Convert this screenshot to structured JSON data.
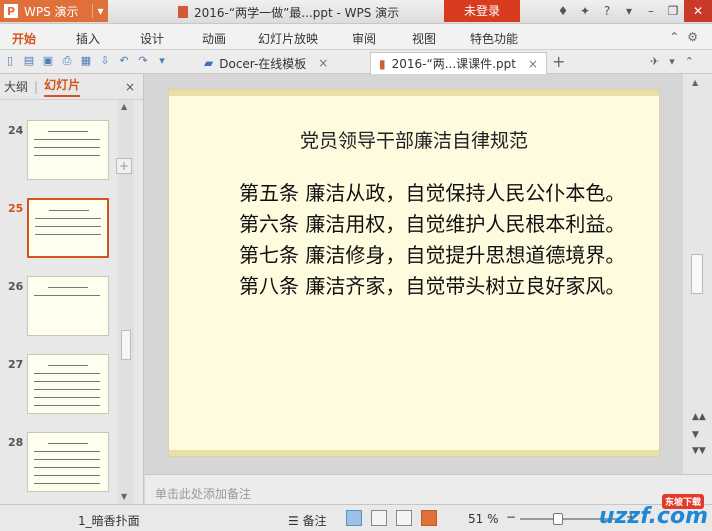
{
  "app": {
    "name": "WPS 演示",
    "doc_title": "2016-“两学一做”最...ppt - WPS 演示",
    "login": "未登录"
  },
  "menu": [
    "开始",
    "插入",
    "设计",
    "动画",
    "幻灯片放映",
    "审阅",
    "视图",
    "特色功能"
  ],
  "tabs": [
    {
      "label": "Docer-在线模板",
      "close": "×"
    },
    {
      "label": "2016-“两...课课件.ppt",
      "close": "×"
    }
  ],
  "sidebar": {
    "outline": "大纲",
    "slides": "幻灯片",
    "close": "×",
    "add": "+"
  },
  "thumbs": [
    {
      "num": "24",
      "lines": 4
    },
    {
      "num": "25",
      "lines": 4,
      "selected": true
    },
    {
      "num": "26",
      "lines": 2
    },
    {
      "num": "27",
      "lines": 6
    },
    {
      "num": "28",
      "lines": 6
    }
  ],
  "slide": {
    "title": "党员领导干部廉洁自律规范",
    "paragraphs": [
      "第五条  廉洁从政，自觉保持人民公仆本色。",
      "第六条  廉洁用权，自觉维护人民根本利益。",
      "第七条  廉洁修身，自觉提升思想道德境界。",
      "第八条  廉洁齐家，自觉带头树立良好家风。"
    ]
  },
  "notes_placeholder": "单击此处添加备注",
  "status": {
    "slide_name": "1_暗香扑面",
    "notes": "备注",
    "zoom": "51 %",
    "zoom_level": 0.51,
    "zoom_minus": "−",
    "zoom_plus": "+"
  },
  "watermark": {
    "text": "uzzf.com",
    "badge": "东坡下载"
  }
}
